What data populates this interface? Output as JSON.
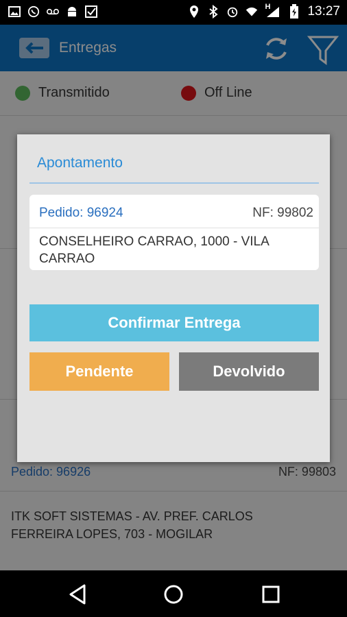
{
  "status_bar": {
    "time": "13:27",
    "left_icons": [
      "image-icon",
      "whatsapp-icon",
      "voicemail-icon",
      "android-icon",
      "task-icon"
    ],
    "right_icons": [
      "location-icon",
      "bluetooth-icon",
      "alarm-icon",
      "wifi-icon",
      "signal-icon",
      "battery-icon"
    ],
    "network_letter": "H"
  },
  "app_bar": {
    "title": "Entregas",
    "background": "#0d73c4"
  },
  "legend": {
    "transmitted_label": "Transmitido",
    "transmitted_color": "#5cb85c",
    "offline_label": "Off Line",
    "offline_color": "#d9151b"
  },
  "background_list": {
    "last_item": {
      "pedido": "Pedido: 96926",
      "nf": "NF: 99803",
      "address": "ITK SOFT SISTEMAS - AV. PREF. CARLOS FERREIRA LOPES, 703 - MOGILAR"
    }
  },
  "dialog": {
    "title": "Apontamento",
    "card": {
      "pedido": "Pedido: 96924",
      "nf": "NF: 99802",
      "address": "CONSELHEIRO CARRAO, 1000 - VILA CARRAO"
    },
    "confirm_label": "Confirmar Entrega",
    "pending_label": "Pendente",
    "returned_label": "Devolvido",
    "confirm_color": "#5bc0de",
    "pending_color": "#f0ad4e",
    "returned_color": "#7b7b7b"
  },
  "nav_bar": {
    "icons": [
      "back-nav-icon",
      "home-nav-icon",
      "recents-nav-icon"
    ]
  }
}
